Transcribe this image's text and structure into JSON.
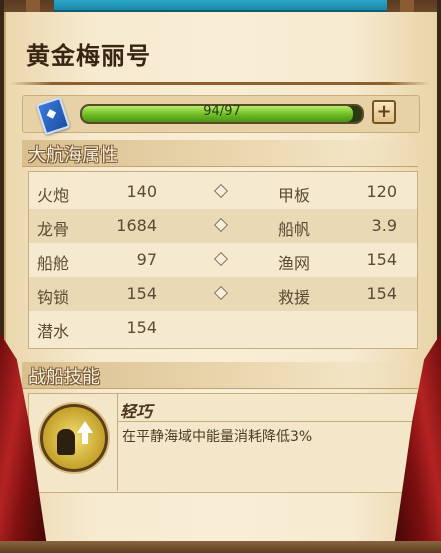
{
  "ship": {
    "name": "黄金梅丽号"
  },
  "durability": {
    "text": "94/97",
    "current": 94,
    "max": 97,
    "fraction": 0.969,
    "plus_label": "+"
  },
  "sections": {
    "attributes_title": "大航海属性",
    "skills_title": "战船技能"
  },
  "attributes": [
    {
      "left": {
        "name": "火炮",
        "value": "140"
      },
      "right": {
        "name": "甲板",
        "value": "120"
      }
    },
    {
      "left": {
        "name": "龙骨",
        "value": "1684"
      },
      "right": {
        "name": "船帆",
        "value": "3.9"
      }
    },
    {
      "left": {
        "name": "船舱",
        "value": "97"
      },
      "right": {
        "name": "渔网",
        "value": "154"
      }
    },
    {
      "left": {
        "name": "钩锁",
        "value": "154"
      },
      "right": {
        "name": "救援",
        "value": "154"
      }
    },
    {
      "left": {
        "name": "潜水",
        "value": "154"
      }
    }
  ],
  "skill": {
    "name": "轻巧",
    "description": "在平静海域中能量消耗降低3%",
    "icon": "ship-skill-medallion-icon"
  },
  "colors": {
    "bar_fill": "#7cc42c",
    "curtain": "#b52323",
    "top_accent": "#2aa8c8"
  }
}
